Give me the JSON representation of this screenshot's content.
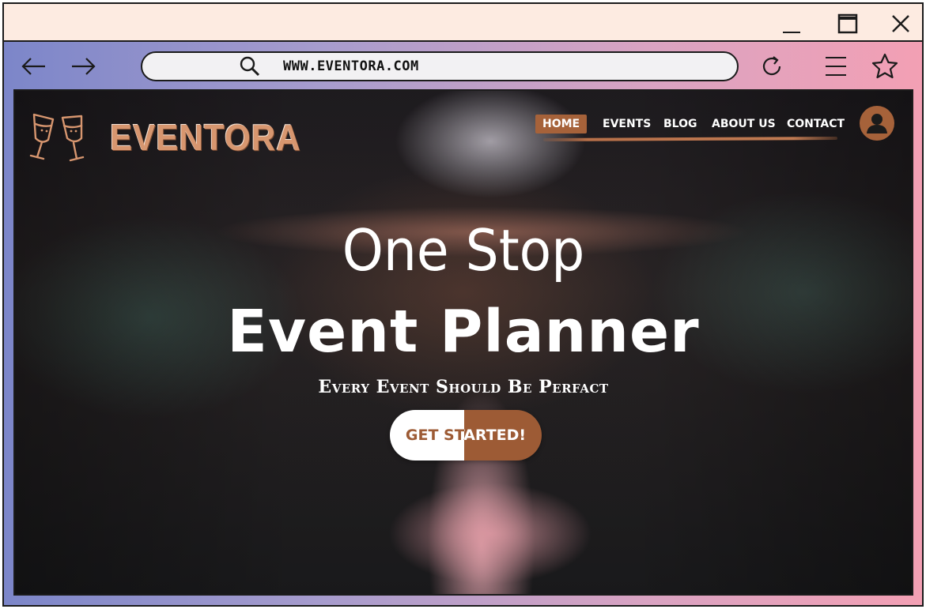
{
  "browser": {
    "url": "WWW.EVENTORA.COM",
    "controls": {
      "minimize_icon": "minimize-icon",
      "maximize_icon": "maximize-icon",
      "close_icon": "close-icon"
    },
    "toolbar_icons": [
      "back-arrow-icon",
      "forward-arrow-icon",
      "search-icon",
      "reload-icon",
      "menu-icon",
      "star-icon"
    ]
  },
  "site": {
    "brand": "EVENTORA",
    "nav": [
      {
        "label": "HOME",
        "active": true
      },
      {
        "label": "EVENTS",
        "active": false
      },
      {
        "label": "BLOG",
        "active": false
      },
      {
        "label": "ABOUT US",
        "active": false
      },
      {
        "label": "CONTACT",
        "active": false
      }
    ],
    "hero": {
      "line1": "One Stop",
      "line2": "Event Planner",
      "tagline": "Every Event Should Be Perfact",
      "cta": "GET STARTED!"
    }
  },
  "colors": {
    "accent": "#a6623a",
    "brand_text": "#d7966f",
    "titlebar": "#fdebe1"
  }
}
